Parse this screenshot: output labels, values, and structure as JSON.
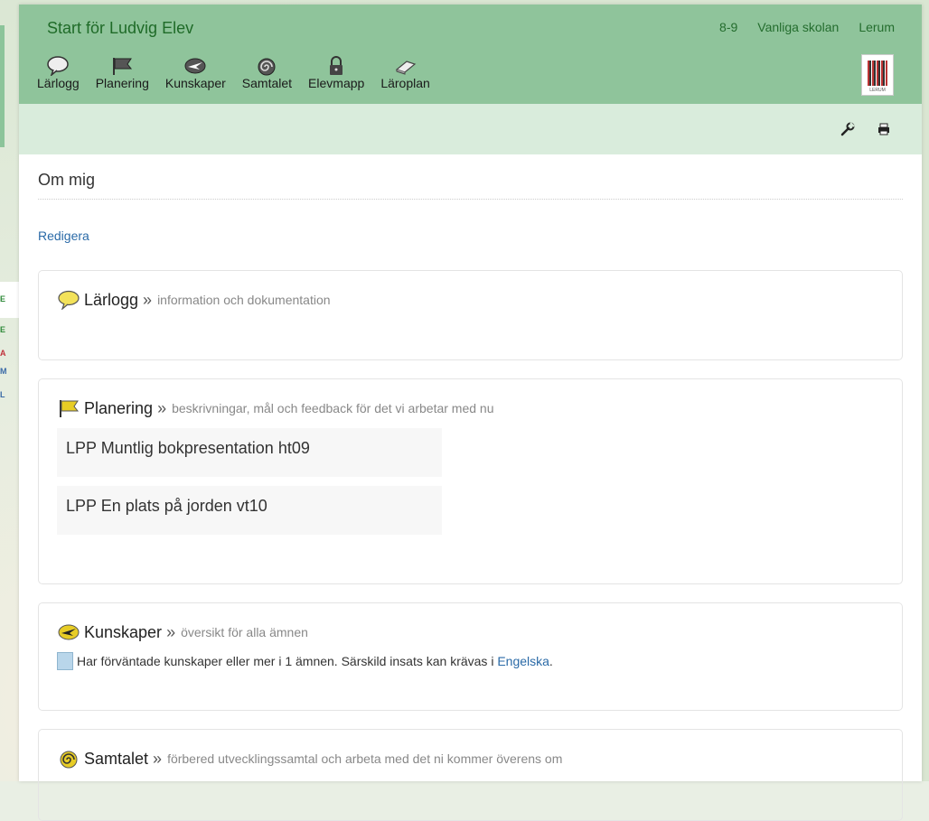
{
  "app": {
    "title": "Start för Ludvig Elev",
    "top_links": [
      "8-9",
      "Vanliga skolan",
      "Lerum"
    ]
  },
  "nav": [
    {
      "label": "Lärlogg",
      "icon": "speech-bubble-icon"
    },
    {
      "label": "Planering",
      "icon": "flag-icon"
    },
    {
      "label": "Kunskaper",
      "icon": "plane-icon"
    },
    {
      "label": "Samtalet",
      "icon": "spiral-icon"
    },
    {
      "label": "Elevmapp",
      "icon": "lock-icon"
    },
    {
      "label": "Läroplan",
      "icon": "book-icon"
    }
  ],
  "logo": {
    "text": "LERUM"
  },
  "toolbar": {
    "tools": [
      "wrench-icon",
      "printer-icon"
    ]
  },
  "left_peek": {
    "letters": [
      "E",
      "E",
      "A",
      "M",
      "L"
    ]
  },
  "main": {
    "section_title": "Om mig",
    "edit_link": "Redigera",
    "panels": {
      "larlogg": {
        "name": "Lärlogg",
        "raquo": "»",
        "desc": "information och dokumentation"
      },
      "planering": {
        "name": "Planering",
        "raquo": "»",
        "desc": "beskrivningar, mål och feedback för det vi arbetar med nu",
        "items": [
          "LPP Muntlig bokpresentation ht09",
          "LPP En plats på jorden vt10"
        ]
      },
      "kunskaper": {
        "name": "Kunskaper",
        "raquo": "»",
        "desc": "översikt för alla ämnen",
        "status_text": "Har förväntade kunskaper eller mer i 1 ämnen. Särskild insats kan krävas i",
        "status_link": "Engelska",
        "status_end": "."
      },
      "samtalet": {
        "name": "Samtalet",
        "raquo": "»",
        "desc": "förbered utvecklingssamtal och arbeta med det ni kommer överens om"
      }
    }
  },
  "colors": {
    "header": "#8fc49b",
    "toolbar": "#d9ecdc",
    "title_text": "#1f6b28",
    "link": "#2a6aa7"
  }
}
